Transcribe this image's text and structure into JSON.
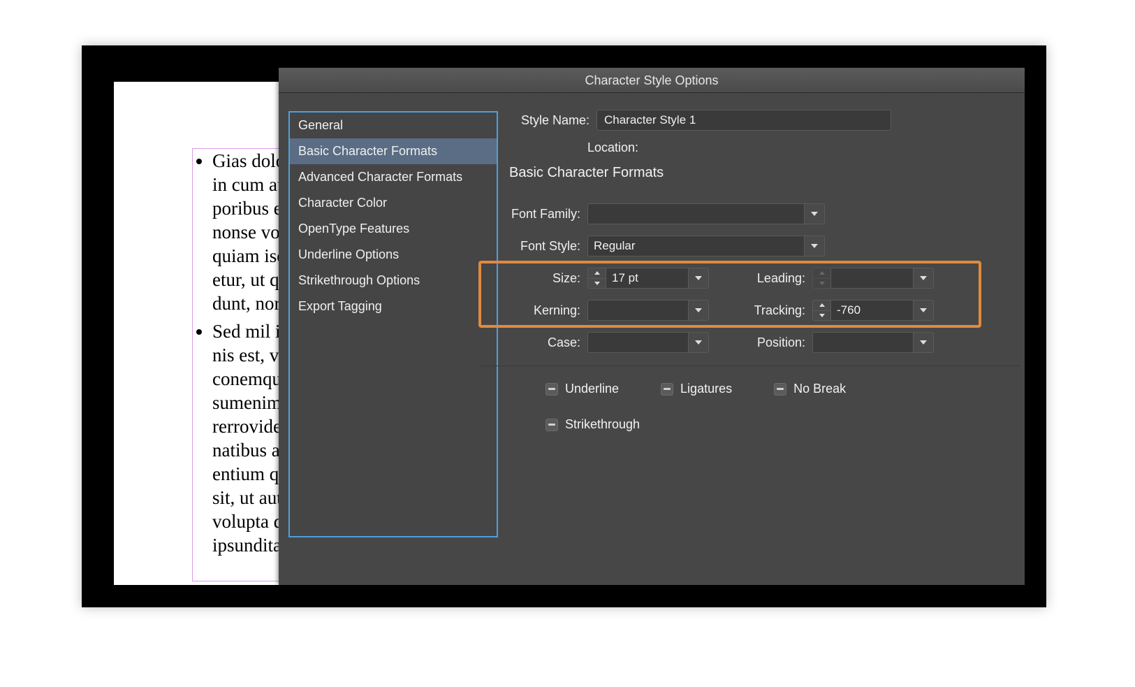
{
  "document": {
    "bullets": [
      "Gias dolo",
      "in cum au",
      "poribus e",
      "nonse vol",
      "quiam isc",
      "etur, ut qu",
      "dunt, nor"
    ],
    "bullets2": [
      "Sed mil in",
      "nis est, vo",
      "conemqu",
      "sumenim",
      "rerrovide",
      "natibus a",
      "entium q",
      "sit, ut aut",
      "volupta q",
      "ipsundita"
    ]
  },
  "dialog": {
    "title": "Character Style Options",
    "sidebar": {
      "items": [
        "General",
        "Basic Character Formats",
        "Advanced Character Formats",
        "Character Color",
        "OpenType Features",
        "Underline Options",
        "Strikethrough Options",
        "Export Tagging"
      ],
      "selected_index": 1
    },
    "fields": {
      "style_name_label": "Style Name:",
      "style_name_value": "Character Style 1",
      "location_label": "Location:",
      "section_title": "Basic Character Formats",
      "font_family_label": "Font Family:",
      "font_family_value": "",
      "font_style_label": "Font Style:",
      "font_style_value": "Regular",
      "size_label": "Size:",
      "size_value": "17 pt",
      "leading_label": "Leading:",
      "leading_value": "",
      "kerning_label": "Kerning:",
      "kerning_value": "",
      "tracking_label": "Tracking:",
      "tracking_value": "-760",
      "case_label": "Case:",
      "case_value": "",
      "position_label": "Position:",
      "position_value": ""
    },
    "checks": {
      "underline": "Underline",
      "ligatures": "Ligatures",
      "no_break": "No Break",
      "strikethrough": "Strikethrough"
    }
  }
}
